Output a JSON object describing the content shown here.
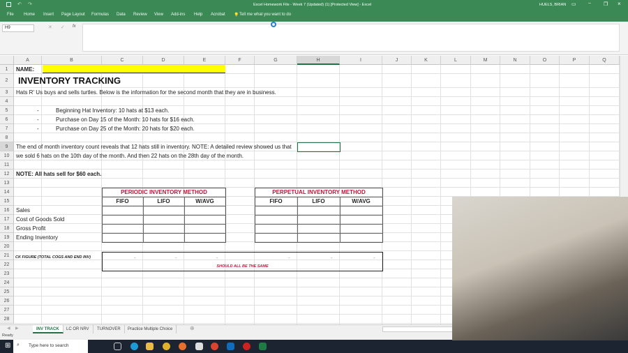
{
  "titlebar": {
    "title": "Excel Homework File - Week 7 (Updated) (1)  [Protected View]  -  Excel",
    "user": "HUELS, BRIAN"
  },
  "ribbon": {
    "tabs": [
      "File",
      "Home",
      "Insert",
      "Page Layout",
      "Formulas",
      "Data",
      "Review",
      "View",
      "Add-ins",
      "Help",
      "Acrobat"
    ],
    "tell_me": "Tell me what you want to do"
  },
  "formula_bar": {
    "name_box": "H9",
    "fx": "fx",
    "value": ""
  },
  "columns": [
    "A",
    "B",
    "C",
    "D",
    "E",
    "F",
    "G",
    "H",
    "I",
    "J",
    "K",
    "L",
    "M",
    "N",
    "O",
    "P",
    "Q"
  ],
  "rows": [
    "1",
    "2",
    "3",
    "4",
    "5",
    "6",
    "7",
    "8",
    "9",
    "10",
    "11",
    "12",
    "13",
    "14",
    "15",
    "16",
    "17",
    "18",
    "19",
    "20",
    "21",
    "22",
    "23",
    "24",
    "25",
    "26",
    "27",
    "28"
  ],
  "sheet": {
    "name_label": "NAME:",
    "title": "INVENTORY TRACKING",
    "intro": "Hats R' Us buys and sells turtles.  Below is the information for the second month that they are in business.",
    "bullet": "-",
    "items": [
      "Beginning Hat Inventory:  10 hats at $13 each.",
      "Purchase on Day 15 of the Month:  10 hats for $16 each.",
      "Purchase on Day 25 of the Month:  20 hats for $20 each."
    ],
    "note1": "The end of month inventory count reveals that 12 hats still in inventory.  NOTE:  A detailed review showed us that",
    "note2": "we sold 6 hats on the 10th day of the month.  And then 22 hats on the 28th day of the month.",
    "note3": "NOTE:  All hats sell for $60 each.",
    "periodic_title": "PERIODIC INVENTORY METHOD",
    "perpetual_title": "PERPETUAL INVENTORY METHOD",
    "methods": [
      "FIFO",
      "LIFO",
      "W/AVG"
    ],
    "row_labels": [
      "Sales",
      "Cost of Goods Sold",
      "Gross Profit",
      "Ending Inventory"
    ],
    "ck_label": "CK FIGURE (TOTAL COGS AND END INV)",
    "ck_values": [
      "-",
      "-",
      "-",
      "-",
      "-",
      "-"
    ],
    "ck_note": "SHOULD ALL BE THE SAME"
  },
  "sheet_tabs": [
    "INV TRACK",
    "LC OR NRV",
    "TURNOVER",
    "Practice Multiple Choice"
  ],
  "active_tab": "INV TRACK",
  "status": "Ready",
  "taskbar": {
    "search_placeholder": "Type here to search"
  },
  "colors": {
    "excel_green": "#3b8a56",
    "highlight_yellow": "#ffff00",
    "red_text": "#c0143c"
  }
}
